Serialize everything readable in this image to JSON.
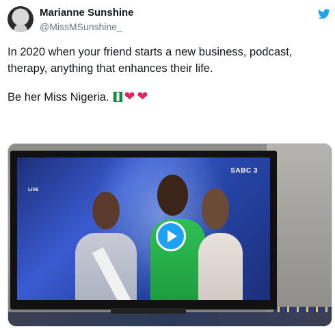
{
  "tweet": {
    "author_name": "Marianne Sunshine",
    "author_handle": "@MissMSunshine_",
    "text_line_1": "In 2020 when your friend starts a new business, podcast,",
    "text_line_2": "therapy, anything that enhances their life.",
    "text_line_3": "Be her Miss Nigeria.",
    "emojis": [
      "nigeria-flag",
      "red-heart",
      "red-heart"
    ],
    "platform_icon": "twitter-bird-icon"
  },
  "media": {
    "type": "video",
    "channel_logo": "SABC 3",
    "live_label": "LIVE",
    "play_icon": "play-icon"
  },
  "colors": {
    "accent": "#1da1f2",
    "text": "#14171a",
    "secondary_text": "#657786",
    "heart": "#e0245e",
    "flag_green": "#118b3f"
  }
}
